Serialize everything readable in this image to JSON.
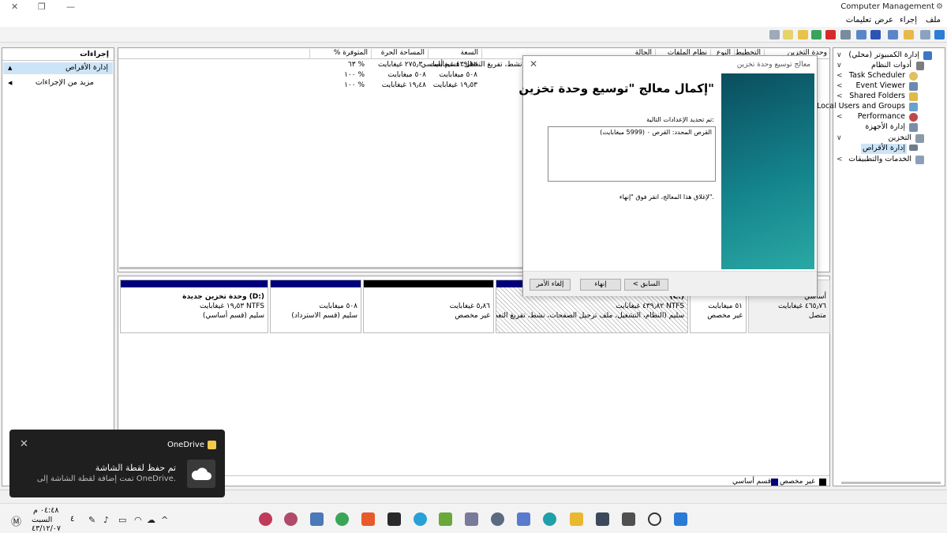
{
  "window": {
    "title": "Computer Management"
  },
  "menu": {
    "file": "ملف",
    "action": "إجراء",
    "view": "عرض",
    "help": "تعليمات"
  },
  "actions_pane": {
    "title": "إجراءات",
    "selected": "إدارة الأقراص",
    "more": "مزيد من الإجراءات"
  },
  "volume_list": {
    "columns": {
      "volume": "وحدة التخزين",
      "layout": "التخطيط",
      "type": "النوع",
      "filesystem": "نظام الملفات",
      "status": "الحالة",
      "capacity": "السعة",
      "free": "المساحة الحرة",
      "pct_free": "% المتوفرة"
    },
    "rows": [
      {
        "status": "نشط، تفريغ التعطل، قسم أساسي)",
        "capacity": "٤٣٩٫٨٢ غيغابايت",
        "free": "٢٧٥٫٣٠ غيغابايت",
        "pct": "٦٣ %"
      },
      {
        "status": "",
        "capacity": "٥٠٨ ميغابايت",
        "free": "٥٠٨ ميغابايت",
        "pct": "١٠٠ %"
      },
      {
        "status": "",
        "capacity": "١٩٫٥٣ غيغابايت",
        "free": "١٩٫٤٨ غيغابايت",
        "pct": "١٠٠ %"
      }
    ]
  },
  "disk_map": {
    "disk": {
      "kind": "أساسي",
      "size": "٤٦٥٫٧٦ غيغابايت",
      "state": "متصل"
    },
    "partitions": [
      {
        "name": "(C:)",
        "size": "٤٣٩٫٨٢ غيغابايت NTFS",
        "status": "سليم (النظام، التشغيل، ملف ترحيل الصفحات، نشط، تفريغ التعطل"
      },
      {
        "name": "",
        "size": "٥١ ميغابايت",
        "status": "غير مخصص"
      },
      {
        "name": "",
        "size": "٥٫٨٦ غيغابايت",
        "status": "غير مخصص"
      },
      {
        "name": "",
        "size": "٥٠٨ ميغابايت",
        "status": "سليم (قسم الاسترداد)"
      },
      {
        "name": "وحدة تخزين جديدة  (D:)",
        "size": "١٩٫٥٣ غيغابايت NTFS",
        "status": "سليم (قسم أساسي)"
      }
    ],
    "legend": {
      "unallocated": "غير مخصص",
      "primary": "قسم أساسي"
    },
    "colors": {
      "primary": "#00007b",
      "unallocated": "#000000"
    }
  },
  "tree": {
    "items": [
      {
        "label": "إدارة الكمبيوتر (محلي)",
        "icon": "computer-icon"
      },
      {
        "label": "أدوات النظام",
        "icon": "tools-icon"
      },
      {
        "label": "Task Scheduler",
        "icon": "clock-icon"
      },
      {
        "label": "Event Viewer",
        "icon": "event-viewer-icon"
      },
      {
        "label": "Shared Folders",
        "icon": "shared-folder-icon"
      },
      {
        "label": "Local Users and Groups",
        "icon": "users-icon"
      },
      {
        "label": "Performance",
        "icon": "performance-icon"
      },
      {
        "label": "إدارة الأجهزة",
        "icon": "device-manager-icon"
      },
      {
        "label": "التخزين",
        "icon": "storage-icon"
      },
      {
        "label": "إدارة الأقراص",
        "icon": "disk-icon"
      },
      {
        "label": "الخدمات والتطبيقات",
        "icon": "services-icon"
      }
    ]
  },
  "wizard": {
    "title": "معالج توسيع وحدة تخزين",
    "heading": "إكمال معالج \"توسيع وحدة تخزين\"",
    "settings_label": "تم تحديد الإعدادات التالية:",
    "settings_text": "القرص المحدد: القرص ٠ (5999 ميغابايت)",
    "close_instruction": "لإغلاق هذا المعالج، انقر فوق \"إنهاء\".",
    "back": "< السابق",
    "finish": "إنهاء",
    "cancel": "إلغاء الأمر"
  },
  "toast": {
    "app": "OneDrive",
    "title": "تم حفظ لقطة الشاشة",
    "body": "تمت إضافة لقطة الشاشة إلى OneDrive."
  },
  "taskbar": {
    "time": "٠٤:٤٨ م",
    "day": "السبت",
    "date": "٤٣/١٢/٠٧",
    "tray_number": "٤"
  }
}
